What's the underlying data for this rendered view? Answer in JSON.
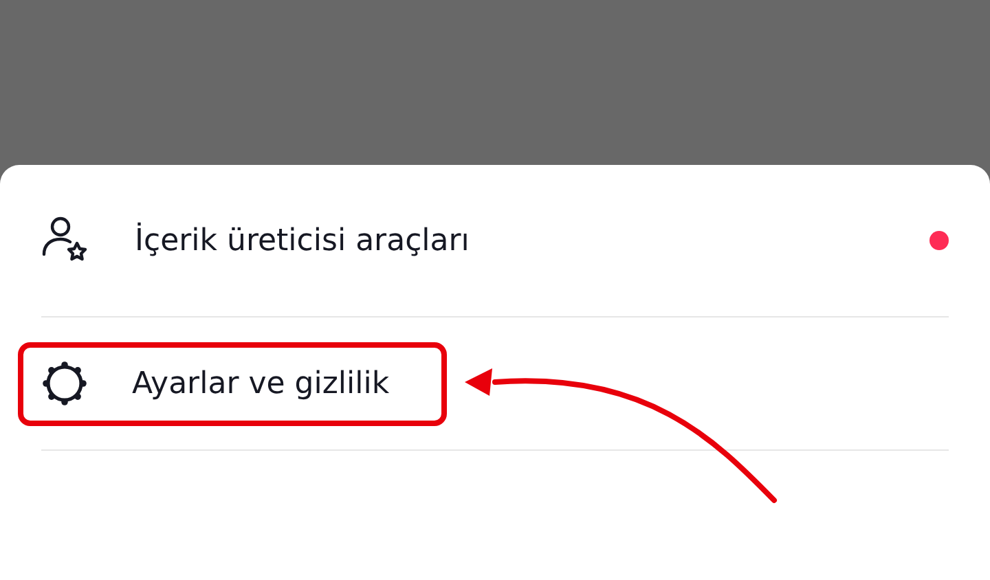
{
  "menu": {
    "items": [
      {
        "kind": "creator",
        "label": "İçerik üreticisi araçları",
        "badge": true,
        "annotated": false
      },
      {
        "kind": "settings",
        "label": "Ayarlar ve gizlilik",
        "badge": false,
        "annotated": true
      }
    ]
  }
}
